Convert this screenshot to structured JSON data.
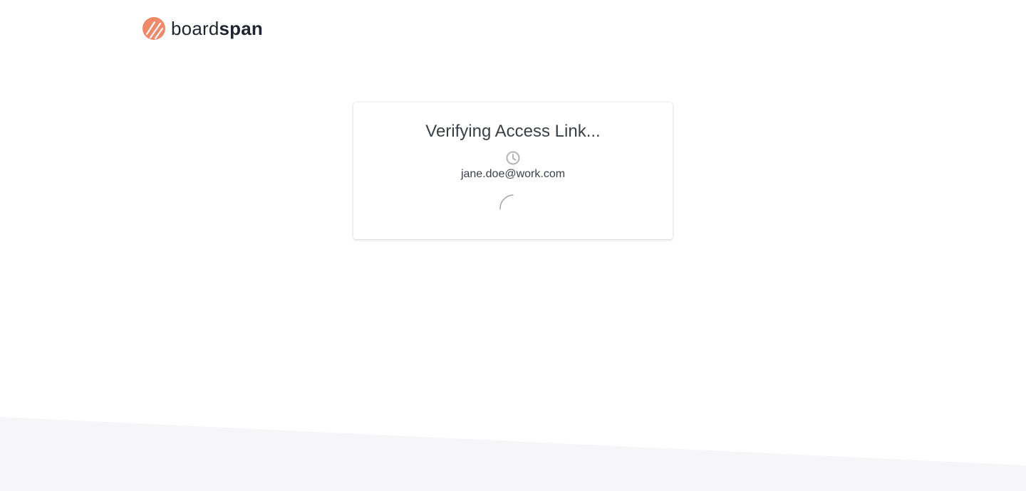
{
  "brand": {
    "name_light": "board",
    "name_bold": "span",
    "logo_icon": "boardspan-logo-icon",
    "accent_color": "#f0896a"
  },
  "verify_card": {
    "title": "Verifying Access Link...",
    "status_icon": "clock-icon",
    "email": "jane.doe@work.com",
    "loading_icon": "spinner-icon"
  },
  "colors": {
    "text_primary": "#3b3f46",
    "background_slant": "#f6f6f8",
    "icon_gray": "#b3b5b9"
  }
}
